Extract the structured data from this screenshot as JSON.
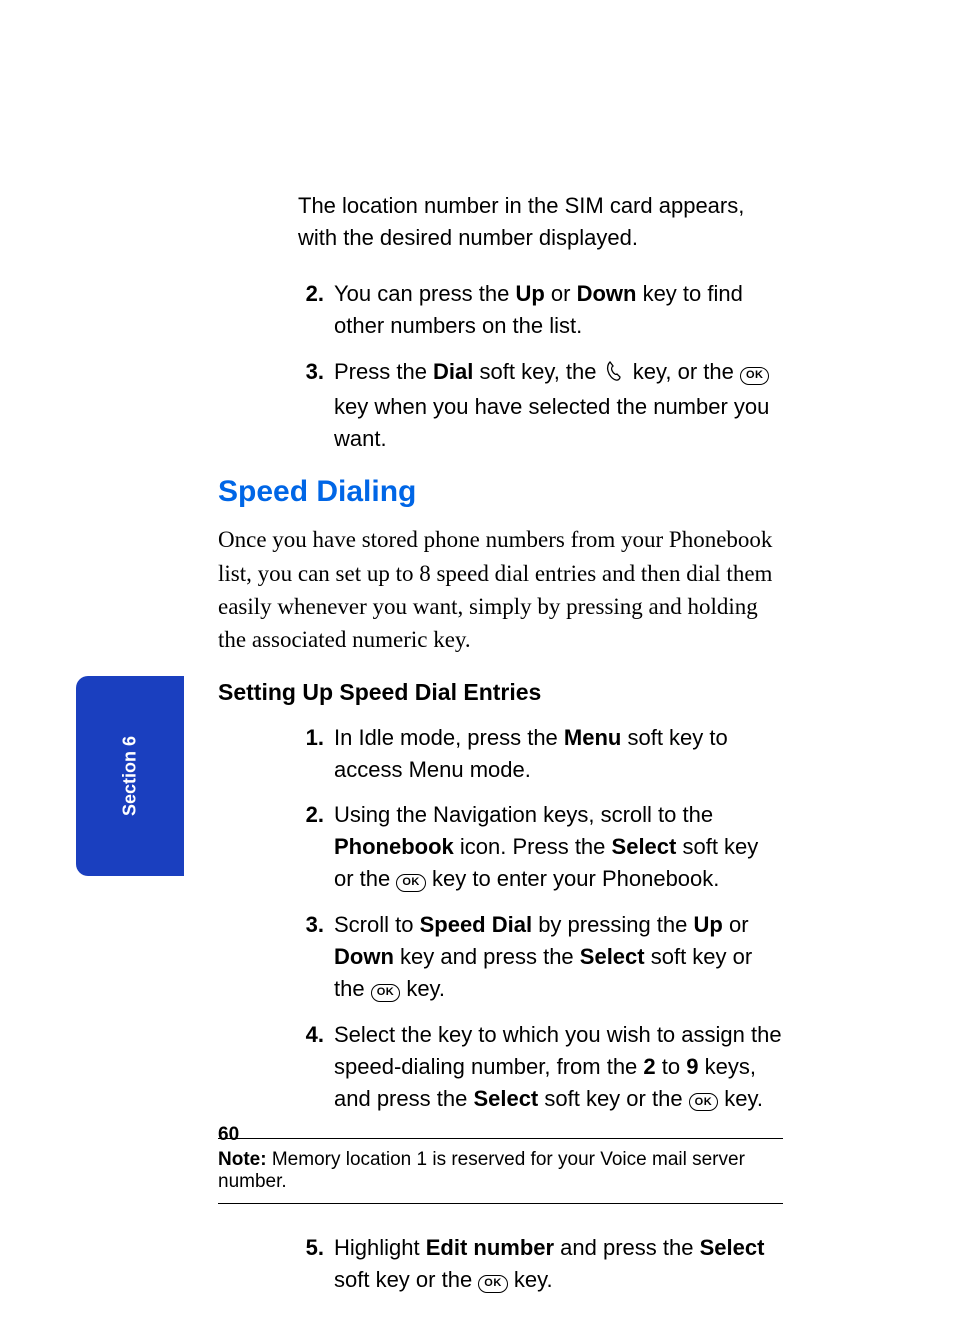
{
  "sideTab": "Section 6",
  "pageNumber": "60",
  "introPara": "The location number in the SIM card appears, with the desired number displayed.",
  "listA": {
    "item2": {
      "num": "2.",
      "pre": "You can press the ",
      "b1": "Up",
      "mid1": " or ",
      "b2": "Down",
      "post": " key to find other numbers on the list."
    },
    "item3": {
      "num": "3.",
      "pre": "Press the ",
      "b1": "Dial",
      "mid1": " soft key, the ",
      "mid2": " key, or the ",
      "post": " key when you have selected the number you want."
    }
  },
  "headingBlue": "Speed Dialing",
  "serifPara": "Once you have stored phone numbers from your Phonebook list, you can set up to 8 speed dial entries and then dial them easily whenever you want, simply by pressing and holding the associated numeric key.",
  "subheading": "Setting Up Speed Dial Entries",
  "listB": {
    "item1": {
      "num": "1.",
      "pre": "In Idle mode, press the ",
      "b1": "Menu",
      "post": " soft key to access Menu mode."
    },
    "item2": {
      "num": "2.",
      "pre": "Using the Navigation keys, scroll to the ",
      "b1": "Phonebook",
      "mid1": " icon. Press the ",
      "b2": "Select",
      "mid2": " soft key or the ",
      "post": " key to enter your Phonebook."
    },
    "item3": {
      "num": "3.",
      "pre": "Scroll to ",
      "b1": "Speed Dial",
      "mid1": " by pressing the ",
      "b2": "Up",
      "mid2": " or ",
      "b3": "Down",
      "mid3": " key and press the ",
      "b4": "Select",
      "mid4": " soft key or the ",
      "post": " key."
    },
    "item4": {
      "num": "4.",
      "pre": "Select the key to which you wish to assign the speed-dialing number, from the ",
      "b1": "2",
      "mid1": " to ",
      "b2": "9",
      "mid2": " keys, and press the ",
      "b3": "Select",
      "mid3": " soft key or the ",
      "post": " key."
    },
    "item5": {
      "num": "5.",
      "pre": "Highlight ",
      "b1": "Edit number",
      "mid1": " and press the ",
      "b2": "Select",
      "mid2": " soft key or the ",
      "post": " key."
    }
  },
  "note": {
    "label": "Note:",
    "text": " Memory location 1 is reserved for your Voice mail server number."
  },
  "okLabel": "OK"
}
